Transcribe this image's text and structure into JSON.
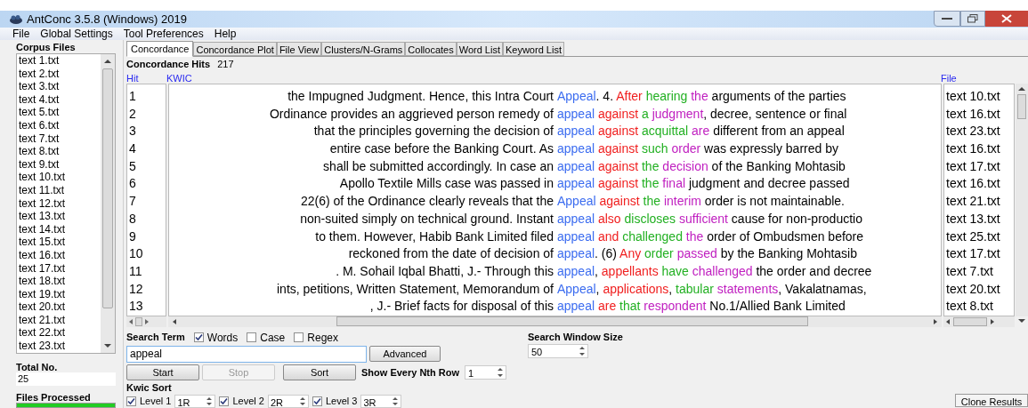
{
  "window": {
    "title": "AntConc 3.5.8 (Windows) 2019"
  },
  "menu": [
    "File",
    "Global Settings",
    "Tool Preferences",
    "Help"
  ],
  "sidebar": {
    "heading": "Corpus Files",
    "files": [
      "text 1.txt",
      "text 2.txt",
      "text 3.txt",
      "text 4.txt",
      "text 5.txt",
      "text 6.txt",
      "text 7.txt",
      "text 8.txt",
      "text 9.txt",
      "text 10.txt",
      "text 11.txt",
      "text 12.txt",
      "text 13.txt",
      "text 14.txt",
      "text 15.txt",
      "text 16.txt",
      "text 17.txt",
      "text 18.txt",
      "text 19.txt",
      "text 20.txt",
      "text 21.txt",
      "text 22.txt",
      "text 23.txt"
    ],
    "total_label": "Total No.",
    "total_value": "25",
    "processed_label": "Files Processed",
    "progress": {
      "level": 1
    }
  },
  "tabs": [
    {
      "label": "Concordance",
      "selected": true
    },
    {
      "label": "Concordance Plot",
      "selected": false
    },
    {
      "label": "File View",
      "selected": false
    },
    {
      "label": "Clusters/N-Grams",
      "selected": false
    },
    {
      "label": "Collocates",
      "selected": false
    },
    {
      "label": "Word List",
      "selected": false
    },
    {
      "label": "Keyword List",
      "selected": false
    }
  ],
  "hits_label": "Concordance Hits",
  "hits_count": "217",
  "columns": {
    "hit": "Hit",
    "kwic": "KWIC",
    "file": "File"
  },
  "rows": [
    {
      "hit": "1",
      "left": "the Impugned Judgment. Hence, this Intra Court",
      "right": [
        {
          "text": "Appeal",
          "color": "#3b6cf0"
        },
        {
          "text": ". 4. ",
          "color": "#000000"
        },
        {
          "text": "After ",
          "color": "#f02020"
        },
        {
          "text": "hearing ",
          "color": "#22b022"
        },
        {
          "text": "the",
          "color": "#c020c0"
        },
        {
          "text": " arguments of the parties",
          "color": "#000000"
        }
      ],
      "file": "text 10.txt"
    },
    {
      "hit": "2",
      "left": "Ordinance provides an aggrieved person remedy of",
      "right": [
        {
          "text": "appeal ",
          "color": "#3b6cf0"
        },
        {
          "text": "against ",
          "color": "#f02020"
        },
        {
          "text": "a ",
          "color": "#22b022"
        },
        {
          "text": "judgment",
          "color": "#c020c0"
        },
        {
          "text": ", decree, sentence or final",
          "color": "#000000"
        }
      ],
      "file": "text 16.txt"
    },
    {
      "hit": "3",
      "left": "that the principles governing the decision of",
      "right": [
        {
          "text": "appeal ",
          "color": "#3b6cf0"
        },
        {
          "text": "against ",
          "color": "#f02020"
        },
        {
          "text": "acquittal ",
          "color": "#22b022"
        },
        {
          "text": "are",
          "color": "#c020c0"
        },
        {
          "text": " different from an appeal",
          "color": "#000000"
        }
      ],
      "file": "text 23.txt"
    },
    {
      "hit": "4",
      "left": "entire case before the Banking Court. As",
      "right": [
        {
          "text": "appeal ",
          "color": "#3b6cf0"
        },
        {
          "text": "against ",
          "color": "#f02020"
        },
        {
          "text": "such ",
          "color": "#22b022"
        },
        {
          "text": "order",
          "color": "#c020c0"
        },
        {
          "text": " was expressly barred by",
          "color": "#000000"
        }
      ],
      "file": "text 16.txt"
    },
    {
      "hit": "5",
      "left": "shall be submitted accordingly. In case an",
      "right": [
        {
          "text": "appeal ",
          "color": "#3b6cf0"
        },
        {
          "text": "against ",
          "color": "#f02020"
        },
        {
          "text": "the ",
          "color": "#22b022"
        },
        {
          "text": "decision",
          "color": "#c020c0"
        },
        {
          "text": " of the Banking Mohtasib",
          "color": "#000000"
        }
      ],
      "file": "text 17.txt"
    },
    {
      "hit": "6",
      "left": "Apollo Textile Mills case was passed in",
      "right": [
        {
          "text": "appeal ",
          "color": "#3b6cf0"
        },
        {
          "text": "against ",
          "color": "#f02020"
        },
        {
          "text": "the ",
          "color": "#22b022"
        },
        {
          "text": "final",
          "color": "#c020c0"
        },
        {
          "text": " judgment and decree passed",
          "color": "#000000"
        }
      ],
      "file": "text 16.txt"
    },
    {
      "hit": "7",
      "left": "22(6) of the Ordinance clearly reveals that the",
      "right": [
        {
          "text": "Appeal ",
          "color": "#3b6cf0"
        },
        {
          "text": "against ",
          "color": "#f02020"
        },
        {
          "text": "the ",
          "color": "#22b022"
        },
        {
          "text": "interim",
          "color": "#c020c0"
        },
        {
          "text": " order is not maintainable.",
          "color": "#000000"
        }
      ],
      "file": "text 21.txt"
    },
    {
      "hit": "8",
      "left": "non-suited simply on technical ground. Instant",
      "right": [
        {
          "text": "appeal ",
          "color": "#3b6cf0"
        },
        {
          "text": "also ",
          "color": "#f02020"
        },
        {
          "text": "discloses ",
          "color": "#22b022"
        },
        {
          "text": "sufficient",
          "color": "#c020c0"
        },
        {
          "text": " cause for non-productio",
          "color": "#000000"
        }
      ],
      "file": "text 13.txt"
    },
    {
      "hit": "9",
      "left": "to them. However, Habib Bank Limited filed",
      "right": [
        {
          "text": "appeal ",
          "color": "#3b6cf0"
        },
        {
          "text": "and ",
          "color": "#f02020"
        },
        {
          "text": "challenged ",
          "color": "#22b022"
        },
        {
          "text": "the",
          "color": "#c020c0"
        },
        {
          "text": " order of Ombudsmen before",
          "color": "#000000"
        }
      ],
      "file": "text 25.txt"
    },
    {
      "hit": "10",
      "left": "reckoned from the date of decision of",
      "right": [
        {
          "text": "appeal",
          "color": "#3b6cf0"
        },
        {
          "text": ". (6) ",
          "color": "#000000"
        },
        {
          "text": "Any ",
          "color": "#f02020"
        },
        {
          "text": "order ",
          "color": "#22b022"
        },
        {
          "text": "passed",
          "color": "#c020c0"
        },
        {
          "text": " by the Banking Mohtasib",
          "color": "#000000"
        }
      ],
      "file": "text 17.txt"
    },
    {
      "hit": "11",
      "left": ". M. Sohail Iqbal Bhatti, J.- Through this",
      "right": [
        {
          "text": "appeal",
          "color": "#3b6cf0"
        },
        {
          "text": ", "
        },
        {
          "text": "appellants ",
          "color": "#f02020"
        },
        {
          "text": "have ",
          "color": "#22b022"
        },
        {
          "text": "challenged",
          "color": "#c020c0"
        },
        {
          "text": " the order and decree",
          "color": "#000000"
        }
      ],
      "file": "text 7.txt"
    },
    {
      "hit": "12",
      "left": "ints, petitions, Written Statement, Memorandum of",
      "right": [
        {
          "text": "Appeal",
          "color": "#3b6cf0"
        },
        {
          "text": ", "
        },
        {
          "text": "applications",
          "color": "#f02020"
        },
        {
          "text": ", "
        },
        {
          "text": "tabular ",
          "color": "#22b022"
        },
        {
          "text": "statements",
          "color": "#c020c0"
        },
        {
          "text": ", Vakalatnamas,",
          "color": "#000000"
        }
      ],
      "file": "text 20.txt"
    },
    {
      "hit": "13",
      "left": ", J.- Brief facts for disposal of this",
      "right": [
        {
          "text": "appeal ",
          "color": "#3b6cf0"
        },
        {
          "text": "are ",
          "color": "#f02020"
        },
        {
          "text": "that ",
          "color": "#22b022"
        },
        {
          "text": "respondent",
          "color": "#c020c0"
        },
        {
          "text": " No.1/Allied Bank Limited",
          "color": "#000000"
        }
      ],
      "file": "text 8.txt"
    }
  ],
  "search": {
    "label": "Search Term",
    "options": [
      {
        "label": "Words",
        "checked": true
      },
      {
        "label": "Case",
        "checked": false
      },
      {
        "label": "Regex",
        "checked": false
      }
    ],
    "value": "appeal",
    "advanced": "Advanced"
  },
  "buttons": [
    {
      "label": "Start",
      "disabled": false
    },
    {
      "label": "Stop",
      "disabled": true
    },
    {
      "label": "Sort",
      "disabled": false
    }
  ],
  "nth_row": {
    "label": "Show Every Nth Row",
    "value": "1"
  },
  "window_size": {
    "label": "Search Window Size",
    "value": "50"
  },
  "kwic_sort": {
    "label": "Kwic Sort",
    "levels": [
      {
        "label": "Level 1",
        "checked": true,
        "value": "1R"
      },
      {
        "label": "Level 2",
        "checked": true,
        "value": "2R"
      },
      {
        "label": "Level 3",
        "checked": true,
        "value": "3R"
      }
    ]
  },
  "clone": "Clone Results"
}
